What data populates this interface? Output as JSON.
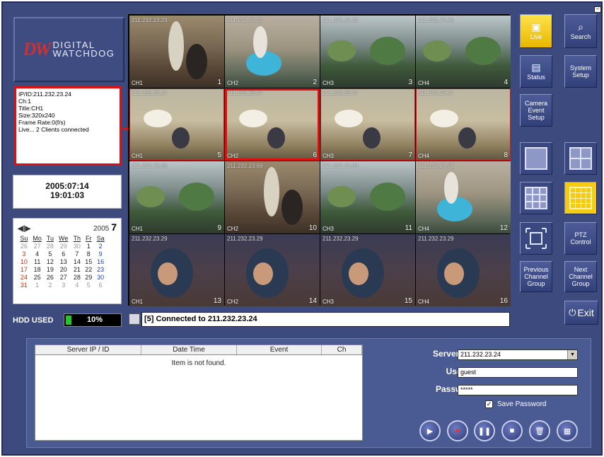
{
  "logo": {
    "mark": "DW",
    "line1": "DIGITAL",
    "line2": "WATCHDOG"
  },
  "info": {
    "lines": [
      "IP/ID:211.232.23.24",
      "Ch:1",
      "Title:CH1",
      "Size:320x240",
      "Frame Rate:0(f/s)",
      "Live... 2 Clients connected"
    ]
  },
  "datetime": {
    "date": "2005:07:14",
    "time": "19:01:03"
  },
  "calendar": {
    "year": "2005",
    "month": "7",
    "dow": [
      "Su",
      "Mo",
      "Tu",
      "We",
      "Th",
      "Fr",
      "Sa"
    ],
    "weeks": [
      [
        "26",
        "27",
        "28",
        "29",
        "30",
        "1",
        "2"
      ],
      [
        "3",
        "4",
        "5",
        "6",
        "7",
        "8",
        "9"
      ],
      [
        "10",
        "11",
        "12",
        "13",
        "14",
        "15",
        "16"
      ],
      [
        "17",
        "18",
        "19",
        "20",
        "21",
        "22",
        "23"
      ],
      [
        "24",
        "25",
        "26",
        "27",
        "28",
        "29",
        "30"
      ],
      [
        "31",
        "1",
        "2",
        "3",
        "4",
        "5",
        "6"
      ]
    ]
  },
  "hdd": {
    "label": "HDD USED",
    "value": "10%",
    "fraction": 0.1
  },
  "video": {
    "cells": [
      {
        "ip": "211.232.23.23",
        "ch": "CH1",
        "num": "1",
        "scene": "room"
      },
      {
        "ip": "211.232.23.23",
        "ch": "CH2",
        "num": "2",
        "scene": "tank"
      },
      {
        "ip": "211.232.23.23",
        "ch": "CH3",
        "num": "3",
        "scene": "street"
      },
      {
        "ip": "211.232.23.23",
        "ch": "CH4",
        "num": "4",
        "scene": "street"
      },
      {
        "ip": "211.232.23.24",
        "ch": "CH1",
        "num": "5",
        "scene": "office"
      },
      {
        "ip": "211.232.23.24",
        "ch": "CH2",
        "num": "6",
        "scene": "office"
      },
      {
        "ip": "211.232.23.24",
        "ch": "CH3",
        "num": "7",
        "scene": "office"
      },
      {
        "ip": "211.232.23.24",
        "ch": "CH4",
        "num": "8",
        "scene": "office"
      },
      {
        "ip": "211.232.23.69",
        "ch": "CH1",
        "num": "9",
        "scene": "street"
      },
      {
        "ip": "211.232.23.69",
        "ch": "CH2",
        "num": "10",
        "scene": "room"
      },
      {
        "ip": "211.232.23.69",
        "ch": "CH3",
        "num": "11",
        "scene": "street"
      },
      {
        "ip": "211.232.23.69",
        "ch": "CH4",
        "num": "12",
        "scene": "tank"
      },
      {
        "ip": "211.232.23.29",
        "ch": "CH1",
        "num": "13",
        "scene": "face"
      },
      {
        "ip": "211.232.23.29",
        "ch": "CH2",
        "num": "14",
        "scene": "face"
      },
      {
        "ip": "211.232.23.29",
        "ch": "CH3",
        "num": "15",
        "scene": "face"
      },
      {
        "ip": "211.232.23.29",
        "ch": "CH4",
        "num": "16",
        "scene": "face"
      }
    ]
  },
  "status": {
    "text": "[5] Connected to 211.232.23.24"
  },
  "buttons": {
    "live": "Live",
    "search": "Search",
    "status": "Status",
    "system_setup_1": "System",
    "system_setup_2": "Setup",
    "camera_event_1": "Camera",
    "camera_event_2": "Event",
    "camera_event_3": "Setup",
    "ptz_1": "PTZ",
    "ptz_2": "Control",
    "prev_1": "Previous",
    "prev_2": "Channel",
    "prev_3": "Group",
    "next_1": "Next",
    "next_2": "Channel",
    "next_3": "Group",
    "exit": "Exit"
  },
  "table": {
    "columns": [
      "Server IP / ID",
      "Date Time",
      "Event",
      "Ch"
    ],
    "empty": "Item is not found."
  },
  "form": {
    "server_label": "Server IP/ ID :",
    "server_value": "211.232.23.24",
    "user_label": "User ID :",
    "user_value": "guest",
    "password_label": "Password :",
    "password_value": "*****",
    "save_password_label": "Save Password",
    "save_password_checked": true
  },
  "icons": {
    "live": "camera-icon",
    "search": "search-icon",
    "status": "monitor-icon",
    "exit": "power-icon",
    "play": "play-icon",
    "record": "record-icon",
    "pause": "pause-icon",
    "stop": "stop-icon",
    "delete": "trash-icon",
    "backup": "save-icon"
  },
  "colors": {
    "background": "#3d4a7e",
    "accent": "#f6cc12",
    "highlight": "#e01010",
    "hdd": "#27c42a"
  }
}
